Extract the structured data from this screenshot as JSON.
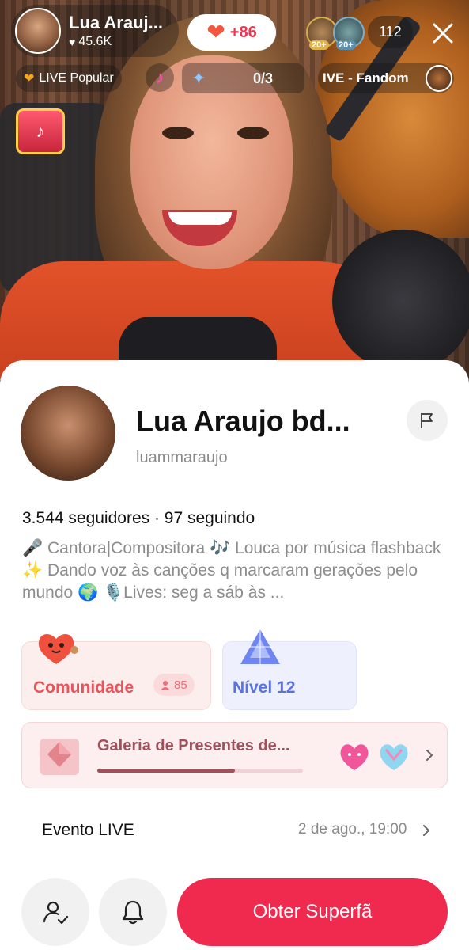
{
  "live": {
    "host_name": "Lua Arauj...",
    "host_likes": "45.6K",
    "like_increment": "+86",
    "viewer_levels": [
      "20+",
      "20+"
    ],
    "viewer_count": "112",
    "popular_label": "LIVE Popular",
    "goal_progress": "0/3",
    "fandom_label": "IVE - Fandom"
  },
  "profile": {
    "display_name": "Lua Araujo bd...",
    "username": "luammaraujo",
    "followers_line": "3.544 seguidores · 97 seguindo",
    "bio": "🎤 Cantora|Compositora 🎶 Louca por música flashback ✨ Dando voz às canções q marcaram gerações pelo mundo 🌍 🎙️Lives: seg a sáb às  ..."
  },
  "cards": {
    "community_label": "Comunidade",
    "community_members": "85",
    "level_label": "Nível 12"
  },
  "gallery": {
    "title": "Galeria de Presentes de...",
    "progress": 0.67
  },
  "event": {
    "label": "Evento LIVE",
    "time": "2 de ago., 19:00"
  },
  "actions": {
    "superfan_label": "Obter Superfã"
  },
  "colors": {
    "accent": "#f0294e",
    "community": "#e8545a",
    "level": "#5a72e0"
  }
}
